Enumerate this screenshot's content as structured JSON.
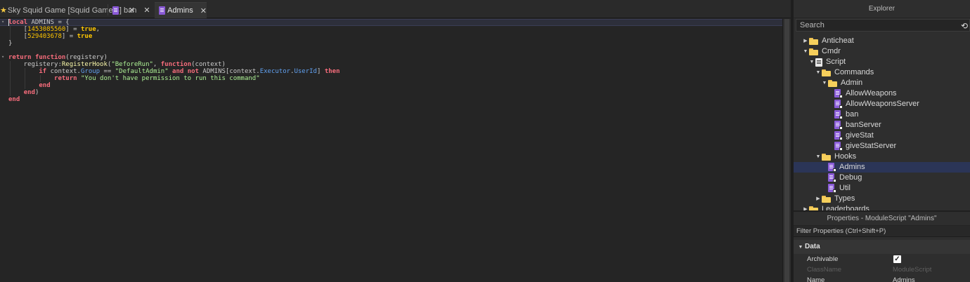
{
  "tabs": [
    {
      "label": "Sky Squid Game [Squid Game 3]"
    },
    {
      "label": "ban"
    },
    {
      "label": "Admins"
    }
  ],
  "code": {
    "lines": [
      [
        {
          "t": "local",
          "c": "kw"
        },
        {
          "t": " ADMINS = {",
          "c": "op"
        }
      ],
      [
        {
          "t": "    [",
          "c": "op"
        },
        {
          "t": "1453085560",
          "c": "num"
        },
        {
          "t": "] = ",
          "c": "op"
        },
        {
          "t": "true",
          "c": "bool"
        },
        {
          "t": ",",
          "c": "op"
        }
      ],
      [
        {
          "t": "    [",
          "c": "op"
        },
        {
          "t": "529403678",
          "c": "num"
        },
        {
          "t": "] = ",
          "c": "op"
        },
        {
          "t": "true",
          "c": "bool"
        }
      ],
      [
        {
          "t": "}",
          "c": "op"
        }
      ],
      [],
      [
        {
          "t": "return",
          "c": "kw"
        },
        {
          "t": " ",
          "c": "op"
        },
        {
          "t": "function",
          "c": "kw"
        },
        {
          "t": "(registery)",
          "c": "op"
        }
      ],
      [
        {
          "t": "    registery:",
          "c": "op"
        },
        {
          "t": "RegisterHook",
          "c": "fn"
        },
        {
          "t": "(",
          "c": "op"
        },
        {
          "t": "\"BeforeRun\"",
          "c": "str"
        },
        {
          "t": ", ",
          "c": "op"
        },
        {
          "t": "function",
          "c": "kw"
        },
        {
          "t": "(context)",
          "c": "op"
        }
      ],
      [
        {
          "t": "        ",
          "c": "op"
        },
        {
          "t": "if",
          "c": "kw"
        },
        {
          "t": " context.",
          "c": "op"
        },
        {
          "t": "Group",
          "c": "prop"
        },
        {
          "t": " == ",
          "c": "op"
        },
        {
          "t": "\"DefaultAdmin\"",
          "c": "str"
        },
        {
          "t": " ",
          "c": "op"
        },
        {
          "t": "and not",
          "c": "kw"
        },
        {
          "t": " ADMINS[context.",
          "c": "op"
        },
        {
          "t": "Executor",
          "c": "prop"
        },
        {
          "t": ".",
          "c": "op"
        },
        {
          "t": "UserId",
          "c": "prop"
        },
        {
          "t": "] ",
          "c": "op"
        },
        {
          "t": "then",
          "c": "kw"
        }
      ],
      [
        {
          "t": "            ",
          "c": "op"
        },
        {
          "t": "return",
          "c": "kw"
        },
        {
          "t": " ",
          "c": "op"
        },
        {
          "t": "\"You don't have permission to run this command\"",
          "c": "str"
        }
      ],
      [
        {
          "t": "        ",
          "c": "op"
        },
        {
          "t": "end",
          "c": "kw"
        }
      ],
      [
        {
          "t": "    ",
          "c": "op"
        },
        {
          "t": "end",
          "c": "kw"
        },
        {
          "t": ")",
          "c": "op"
        }
      ],
      [
        {
          "t": "end",
          "c": "kw"
        }
      ]
    ]
  },
  "explorer": {
    "title": "Explorer",
    "search_placeholder": "Search",
    "nodes": [
      {
        "label": "Anticheat",
        "icon": "folder",
        "depth": 0,
        "arrow": "right"
      },
      {
        "label": "Cmdr",
        "icon": "folder",
        "depth": 0,
        "arrow": "down"
      },
      {
        "label": "Script",
        "icon": "script",
        "depth": 1,
        "arrow": "down"
      },
      {
        "label": "Commands",
        "icon": "folder",
        "depth": 2,
        "arrow": "down"
      },
      {
        "label": "Admin",
        "icon": "folder",
        "depth": 3,
        "arrow": "down"
      },
      {
        "label": "AllowWeapons",
        "icon": "module",
        "depth": 4,
        "arrow": ""
      },
      {
        "label": "AllowWeaponsServer",
        "icon": "module",
        "depth": 4,
        "arrow": ""
      },
      {
        "label": "ban",
        "icon": "module",
        "depth": 4,
        "arrow": ""
      },
      {
        "label": "banServer",
        "icon": "module",
        "depth": 4,
        "arrow": ""
      },
      {
        "label": "giveStat",
        "icon": "module",
        "depth": 4,
        "arrow": ""
      },
      {
        "label": "giveStatServer",
        "icon": "module",
        "depth": 4,
        "arrow": ""
      },
      {
        "label": "Hooks",
        "icon": "folder",
        "depth": 2,
        "arrow": "down"
      },
      {
        "label": "Admins",
        "icon": "module",
        "depth": 3,
        "arrow": "",
        "selected": true
      },
      {
        "label": "Debug",
        "icon": "module",
        "depth": 3,
        "arrow": ""
      },
      {
        "label": "Util",
        "icon": "module",
        "depth": 3,
        "arrow": ""
      },
      {
        "label": "Types",
        "icon": "folder",
        "depth": 2,
        "arrow": "right"
      },
      {
        "label": "Leaderboards",
        "icon": "folder",
        "depth": 0,
        "arrow": "right"
      }
    ]
  },
  "properties": {
    "title": "Properties - ModuleScript \"Admins\"",
    "filter_placeholder": "Filter Properties (Ctrl+Shift+P)",
    "section": "Data",
    "rows": [
      {
        "name": "Archivable",
        "value": "",
        "checkbox": true,
        "dim": false
      },
      {
        "name": "ClassName",
        "value": "ModuleScript",
        "checkbox": false,
        "dim": true
      },
      {
        "name": "Name",
        "value": "Admins",
        "checkbox": false,
        "dim": false
      }
    ]
  },
  "colors": {
    "keyword": "#f86d7c",
    "string": "#adf195",
    "number": "#ffc600",
    "property": "#61a1f1",
    "selection": "#2b3557",
    "module_icon": "#8b5cd8",
    "folder_icon": "#f6cf5c"
  }
}
